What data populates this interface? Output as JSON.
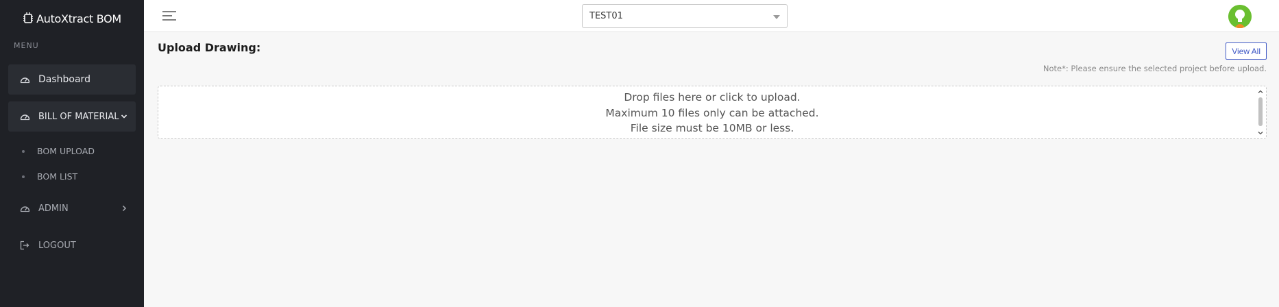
{
  "brand": {
    "name": "AutoXtract BOM"
  },
  "sidebar": {
    "menu_heading": "MENU",
    "items": [
      {
        "label": "Dashboard",
        "icon": "speedometer-icon"
      },
      {
        "label": "BILL OF MATERIAL",
        "icon": "speedometer-icon",
        "expanded": true,
        "sub": [
          {
            "label": "BOM UPLOAD"
          },
          {
            "label": "BOM LIST"
          }
        ]
      },
      {
        "label": "ADMIN",
        "icon": "speedometer-icon"
      },
      {
        "label": "LOGOUT",
        "icon": "logout-icon"
      }
    ]
  },
  "header": {
    "project_select": {
      "value": "TEST01"
    }
  },
  "main": {
    "title": "Upload Drawing:",
    "view_all_label": "View All",
    "note": "Note*: Please ensure the selected project before upload.",
    "dropzone": {
      "line1": "Drop files here or click to upload.",
      "line2": "Maximum 10 files only can be attached.",
      "line3": "File size must be 10MB or less."
    }
  },
  "colors": {
    "sidebar_bg": "#1f2126",
    "accent_blue": "#3d57c5",
    "avatar_green": "#6abf30"
  }
}
